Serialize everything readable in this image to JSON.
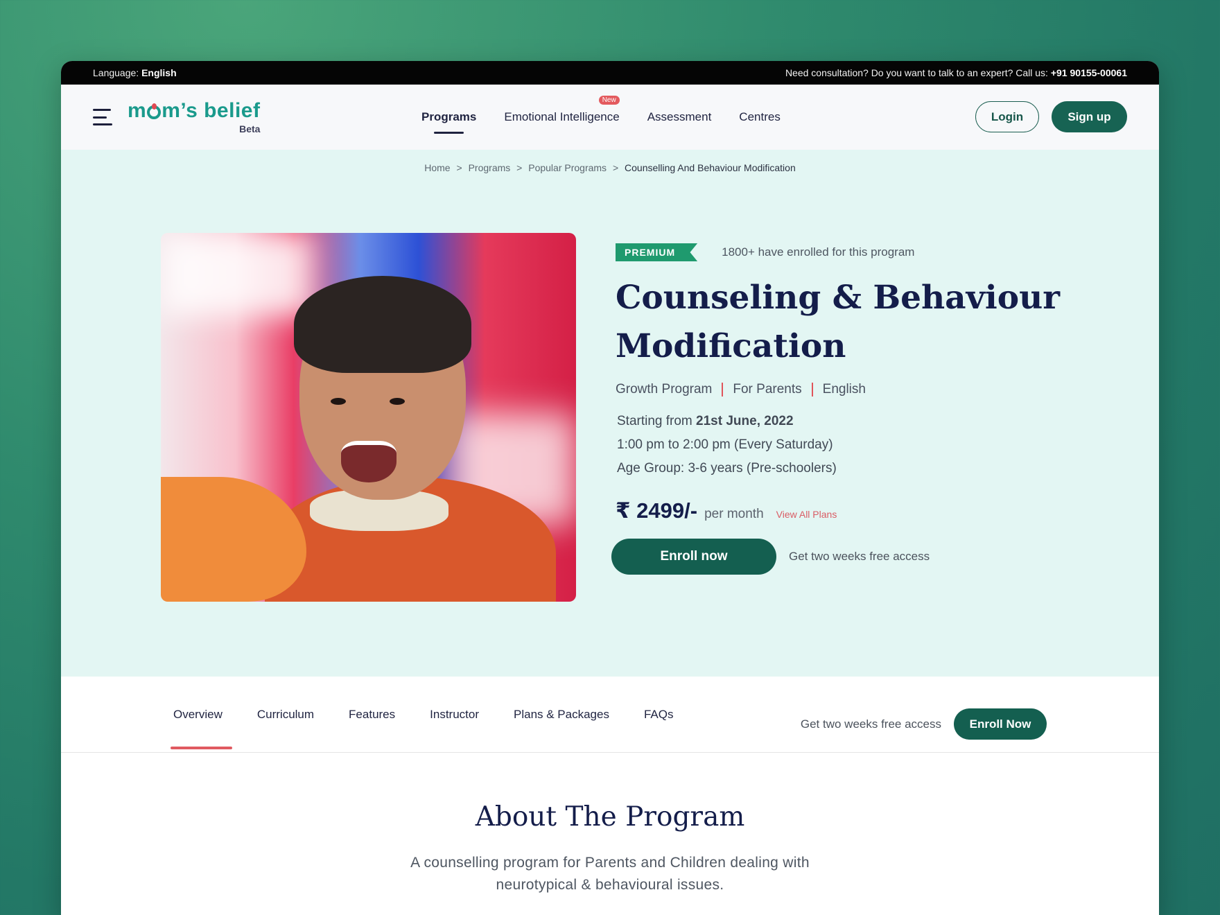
{
  "topbar": {
    "language_label": "Language:",
    "language_value": "English",
    "consult_text": "Need consultation? Do you want to talk to an expert? Call us:",
    "phone": "+91 90155-00061"
  },
  "header": {
    "logo_text_pre": "m",
    "logo_text_post": "m’s belief",
    "logo_badge": "Beta",
    "nav": [
      {
        "label": "Programs",
        "active": true
      },
      {
        "label": "Emotional Intelligence",
        "badge": "New"
      },
      {
        "label": "Assessment"
      },
      {
        "label": "Centres"
      }
    ],
    "login_label": "Login",
    "signup_label": "Sign up"
  },
  "breadcrumb": {
    "items": [
      "Home",
      "Programs",
      "Popular Programs"
    ],
    "current": "Counselling And Behaviour Modification",
    "separator": ">"
  },
  "program": {
    "badge": "PREMIUM",
    "enrolled": "1800+ have enrolled for this program",
    "title": "Counseling & Behaviour Modification",
    "meta": [
      "Growth Program",
      "For Parents",
      "English"
    ],
    "start_prefix": "Starting from ",
    "start_date": "21st June, 2022",
    "time": "1:00 pm to 2:00 pm (Every Saturday)",
    "age_group": "Age Group: 3-6 years (Pre-schoolers)",
    "price": "₹ 2499/-",
    "price_period": "per month",
    "view_plans": "View All Plans",
    "enroll_label": "Enroll now",
    "free_access": "Get two weeks free access",
    "image_alt": "Smiling child in orange jacket"
  },
  "tabs": {
    "items": [
      "Overview",
      "Curriculum",
      "Features",
      "Instructor",
      "Plans & Packages",
      "FAQs"
    ],
    "active": "Overview",
    "free_access": "Get two weeks free access",
    "enroll_label": "Enroll Now"
  },
  "about": {
    "heading": "About The Program",
    "description": "A counselling program for Parents and Children dealing with neurotypical & behavioural issues."
  },
  "colors": {
    "brand_teal": "#1a9a8c",
    "primary_green": "#145f50",
    "premium_green": "#1f9a6e",
    "accent_red": "#e05a60",
    "navy": "#141d4a",
    "hero_bg": "#e3f6f3"
  }
}
